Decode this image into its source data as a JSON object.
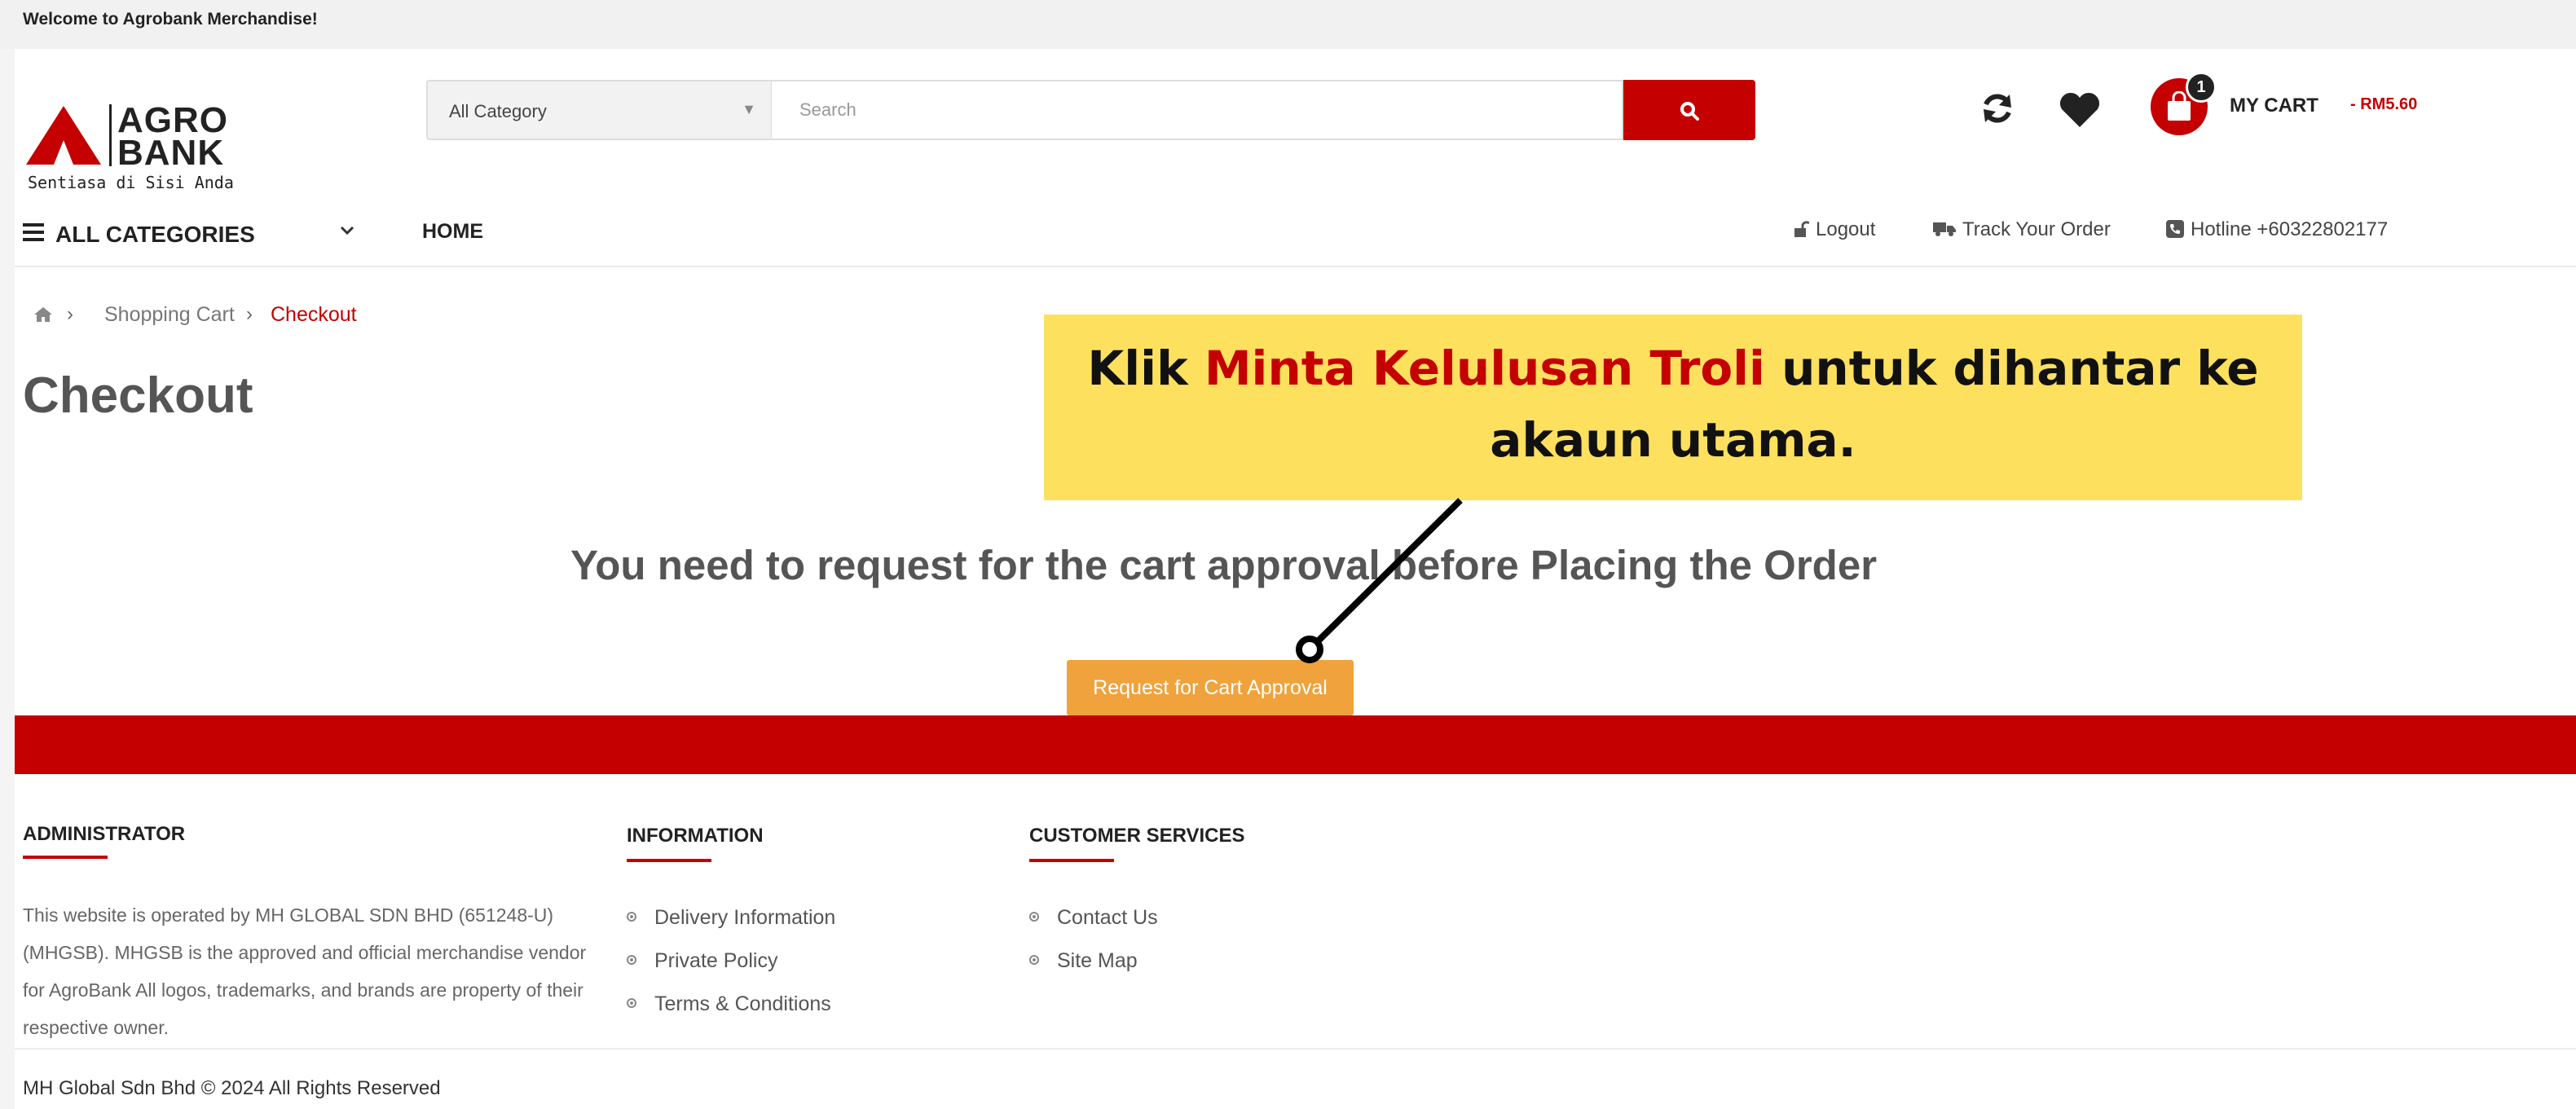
{
  "topbar": {
    "welcome": "Welcome to Agrobank Merchandise!"
  },
  "logo": {
    "line1": "AGRO",
    "line2": "BANK",
    "tagline": "Sentiasa di Sisi Anda"
  },
  "search": {
    "category": "All Category",
    "placeholder": "Search"
  },
  "cart": {
    "count": "1",
    "label": "MY CART",
    "amount": "- RM5.60"
  },
  "nav": {
    "all_categories": "ALL CATEGORIES",
    "home": "HOME",
    "logout": "Logout",
    "track": "Track Your Order",
    "hotline": "Hotline +60322802177"
  },
  "breadcrumb": {
    "shopping_cart": "Shopping Cart",
    "checkout": "Checkout"
  },
  "page": {
    "title": "Checkout",
    "notice": "You need to request for the cart approval before Placing the Order",
    "approve_button": "Request for Cart Approval"
  },
  "callout": {
    "before": "Klik ",
    "highlight": "Minta Kelulusan Troli",
    "after": " untuk dihantar ke akaun utama."
  },
  "footer": {
    "admin_heading": "ADMINISTRATOR",
    "admin_text": "This website is operated by MH GLOBAL SDN BHD (651248-U) (MHGSB). MHGSB is the approved and official merchandise vendor for AgroBank All logos, trademarks, and brands are property of their respective owner.",
    "info_heading": "INFORMATION",
    "info_links": [
      "Delivery Information",
      "Private Policy",
      "Terms & Conditions"
    ],
    "cs_heading": "CUSTOMER SERVICES",
    "cs_links": [
      "Contact Us",
      "Site Map"
    ],
    "copyright": "MH Global Sdn Bhd © 2024 All Rights Reserved"
  },
  "colors": {
    "brand_red": "#c40000",
    "button_orange": "#f0a23c",
    "callout_yellow": "#fde05e"
  },
  "icons": [
    "search-icon",
    "refresh-icon",
    "heart-icon",
    "shopping-bag-icon",
    "menu-icon",
    "chevron-down-icon",
    "unlock-icon",
    "truck-icon",
    "phone-icon",
    "home-icon"
  ]
}
